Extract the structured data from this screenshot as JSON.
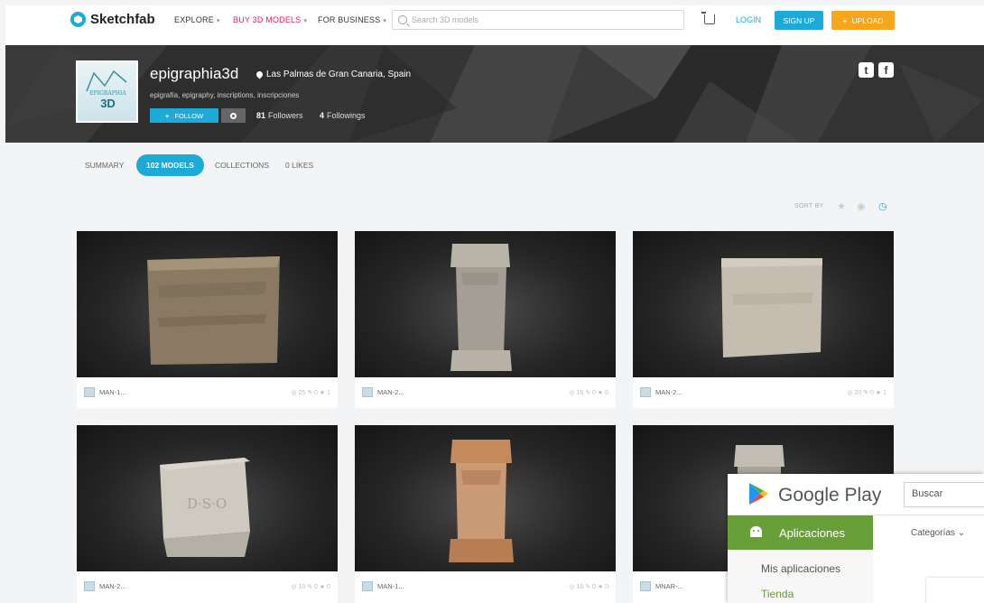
{
  "brand": {
    "name": "Sketchfab"
  },
  "nav": {
    "explore": "EXPLORE",
    "buy": "BUY 3D MODELS",
    "business": "FOR BUSINESS",
    "search_placeholder": "Search 3D models",
    "login": "LOGIN",
    "signup": "SIGN UP",
    "upload": "UPLOAD"
  },
  "profile": {
    "avatar_text1": "EPIGRAPHIA",
    "avatar_text2": "3D",
    "username": "epigraphia3d",
    "location": "Las Palmas de Gran Canaria, Spain",
    "tags": "epigrafía, epigraphy, inscriptions, inscripciones",
    "follow": "FOLLOW",
    "followers_count": "81",
    "followers_label": "Followers",
    "followings_count": "4",
    "followings_label": "Followings",
    "social_twitter": "t",
    "social_facebook": "f"
  },
  "tabs": {
    "summary": "SUMMARY",
    "models": "102 MODELS",
    "collections": "COLLECTIONS",
    "likes": "0 LIKES"
  },
  "sort": {
    "label": "SORT BY"
  },
  "models": [
    {
      "name": "MAN-1...",
      "stats": "◎ 25  ✎ 0  ★ 1"
    },
    {
      "name": "MAN-2...",
      "stats": "◎ 16  ✎ 0  ★ 0"
    },
    {
      "name": "MAN-2...",
      "stats": "◎ 20  ✎ 0  ★ 1"
    },
    {
      "name": "MAN-2...",
      "stats": "◎ 10  ✎ 0  ★ 0"
    },
    {
      "name": "MAN-1...",
      "stats": "◎ 16  ✎ 0  ★ 0"
    },
    {
      "name": "MNAR-...",
      "stats": ""
    }
  ],
  "google_play": {
    "title": "Google Play",
    "search": "Buscar",
    "apps": "Aplicaciones",
    "categories": "Categorías ⌄",
    "my_apps": "Mis aplicaciones",
    "store": "Tienda"
  },
  "colors": {
    "accent": "#1caad9",
    "upload": "#f7a51c",
    "red_nav": "#e0245e",
    "play_green": "#689f38"
  }
}
